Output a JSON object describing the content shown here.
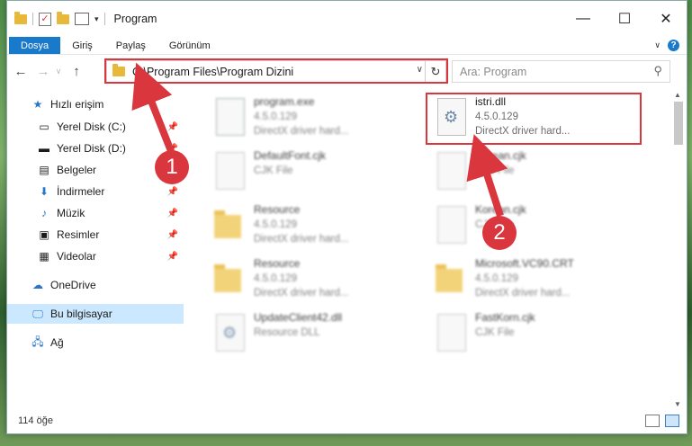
{
  "window": {
    "title": "Program"
  },
  "ribbon": {
    "tabs": [
      "Dosya",
      "Giriş",
      "Paylaş",
      "Görünüm"
    ]
  },
  "address": {
    "path": "C:\\Program Files\\Program Dizini"
  },
  "search": {
    "placeholder": "Ara: Program"
  },
  "nav": {
    "quick_access": "Hızlı erişim",
    "items": [
      {
        "label": "Yerel Disk (C:)",
        "icon": "drive-icon"
      },
      {
        "label": "Yerel Disk (D:)",
        "icon": "drive-icon"
      },
      {
        "label": "Belgeler",
        "icon": "documents-icon"
      },
      {
        "label": "İndirmeler",
        "icon": "download-icon"
      },
      {
        "label": "Müzik",
        "icon": "music-icon"
      },
      {
        "label": "Resimler",
        "icon": "pictures-icon"
      },
      {
        "label": "Videolar",
        "icon": "videos-icon"
      }
    ],
    "onedrive": "OneDrive",
    "this_pc": "Bu bilgisayar",
    "network": "Ağ"
  },
  "files": [
    {
      "name": "program.exe",
      "line2": "4.5.0.129",
      "line3": "DirectX driver hard...",
      "icon": "exe-icon"
    },
    {
      "name": "istri.dll",
      "line2": "4.5.0.129",
      "line3": "DirectX driver hard...",
      "icon": "dll-gear-icon"
    },
    {
      "name": "DefaultFont.cjk",
      "line2": "CJK File",
      "icon": "file-icon"
    },
    {
      "name": "Korean.cjk",
      "line2": "CJK File",
      "icon": "file-icon"
    },
    {
      "name": "Resource",
      "line2": "4.5.0.129",
      "line3": "DirectX driver hard...",
      "icon": "folder-icon"
    },
    {
      "name": "Korean.cjk",
      "line2": "CJK File",
      "icon": "file-icon"
    },
    {
      "name": "Resource",
      "line2": "4.5.0.129",
      "line3": "DirectX driver hard...",
      "icon": "folder-icon"
    },
    {
      "name": "Microsoft.VC90.CRT",
      "line2": "4.5.0.129",
      "line3": "DirectX driver hard...",
      "icon": "folder-icon"
    },
    {
      "name": "UpdateClient42.dll",
      "line2": "Resource DLL",
      "icon": "dll-gear-icon"
    },
    {
      "name": "FastKorn.cjk",
      "line2": "CJK File",
      "icon": "file-icon"
    }
  ],
  "status": {
    "count": "114 öğe"
  },
  "markers": [
    "1",
    "2"
  ],
  "colors": {
    "accent": "#1979ca",
    "highlight": "#d9363e",
    "selection": "#cce8ff"
  }
}
